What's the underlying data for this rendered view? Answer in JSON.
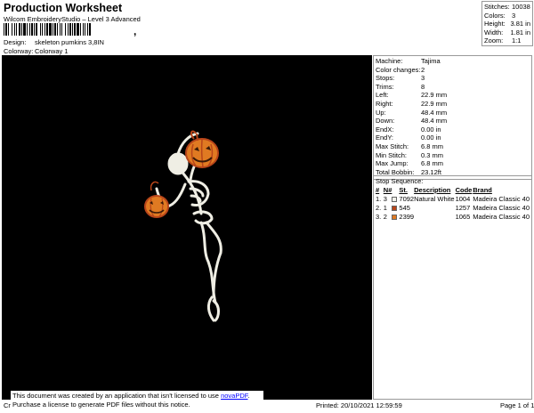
{
  "header": {
    "title": "Production Worksheet",
    "subtitle": "Wilcom EmbroideryStudio – Level 3 Advanced",
    "design_label": "Design:",
    "design_value": "skeleton pumkins 3,8IN",
    "colorway_label": "Colorway:",
    "colorway_value": "Colorway 1",
    "barcode_comma": ","
  },
  "summary": {
    "rows": [
      {
        "k": "Stitches:",
        "v": "10038"
      },
      {
        "k": "Colors:",
        "v": "3"
      },
      {
        "k": "Height:",
        "v": "3.81 in"
      },
      {
        "k": "Width:",
        "v": "1.81 in"
      },
      {
        "k": "Zoom:",
        "v": "1:1"
      }
    ]
  },
  "machine_info": {
    "rows": [
      {
        "k": "Machine:",
        "v": "Tajima"
      },
      {
        "k": "Color changes:",
        "v": "2"
      },
      {
        "k": "Stops:",
        "v": "3"
      },
      {
        "k": "Trims:",
        "v": "8"
      },
      {
        "k": "Left:",
        "v": "22.9 mm"
      },
      {
        "k": "Right:",
        "v": "22.9 mm"
      },
      {
        "k": "Up:",
        "v": "48.4 mm"
      },
      {
        "k": "Down:",
        "v": "48.4 mm"
      },
      {
        "k": "EndX:",
        "v": "0.00 in"
      },
      {
        "k": "EndY:",
        "v": "0.00 in"
      },
      {
        "k": "Max Stitch:",
        "v": "6.8 mm"
      },
      {
        "k": "Min Stitch:",
        "v": "0.3 mm"
      },
      {
        "k": "Max Jump:",
        "v": "6.8 mm"
      },
      {
        "k": "Total Bobbin:",
        "v": "23.12ft"
      }
    ]
  },
  "stop_sequence": {
    "title": "Stop Sequence:",
    "columns": [
      "#",
      "N#",
      "St.",
      "Description",
      "Code",
      "Brand"
    ],
    "rows": [
      {
        "n": "1.",
        "nn": "3",
        "color": "#f2f2ea",
        "st": "7092",
        "desc": "Natural White",
        "code": "1004",
        "brand": "Madeira Classic 40"
      },
      {
        "n": "2.",
        "nn": "1",
        "color": "#b8451a",
        "st": "545",
        "desc": "",
        "code": "1257",
        "brand": "Madeira Classic 40"
      },
      {
        "n": "3.",
        "nn": "2",
        "color": "#e07a22",
        "st": "2399",
        "desc": "",
        "code": "1065",
        "brand": "Madeira Classic 40"
      }
    ]
  },
  "footer": {
    "notice_line1_pre": "This document was created by an application that isn't licensed to use ",
    "notice_link": "novaPDF",
    "notice_line1_post": ".",
    "notice_line2": "Purchase a license to generate PDF files without this notice.",
    "cr": "Cr",
    "printed": "Printed: 20/10/2021 12:59:59",
    "page": "Page 1 of 1"
  },
  "colors": {
    "design_bg": "#000000",
    "thread_white": "#f2f2ea",
    "thread_rust": "#b8451a",
    "thread_orange": "#e07a22"
  },
  "icons": [
    "barcode",
    "skeleton-pumpkin-embroidery"
  ]
}
